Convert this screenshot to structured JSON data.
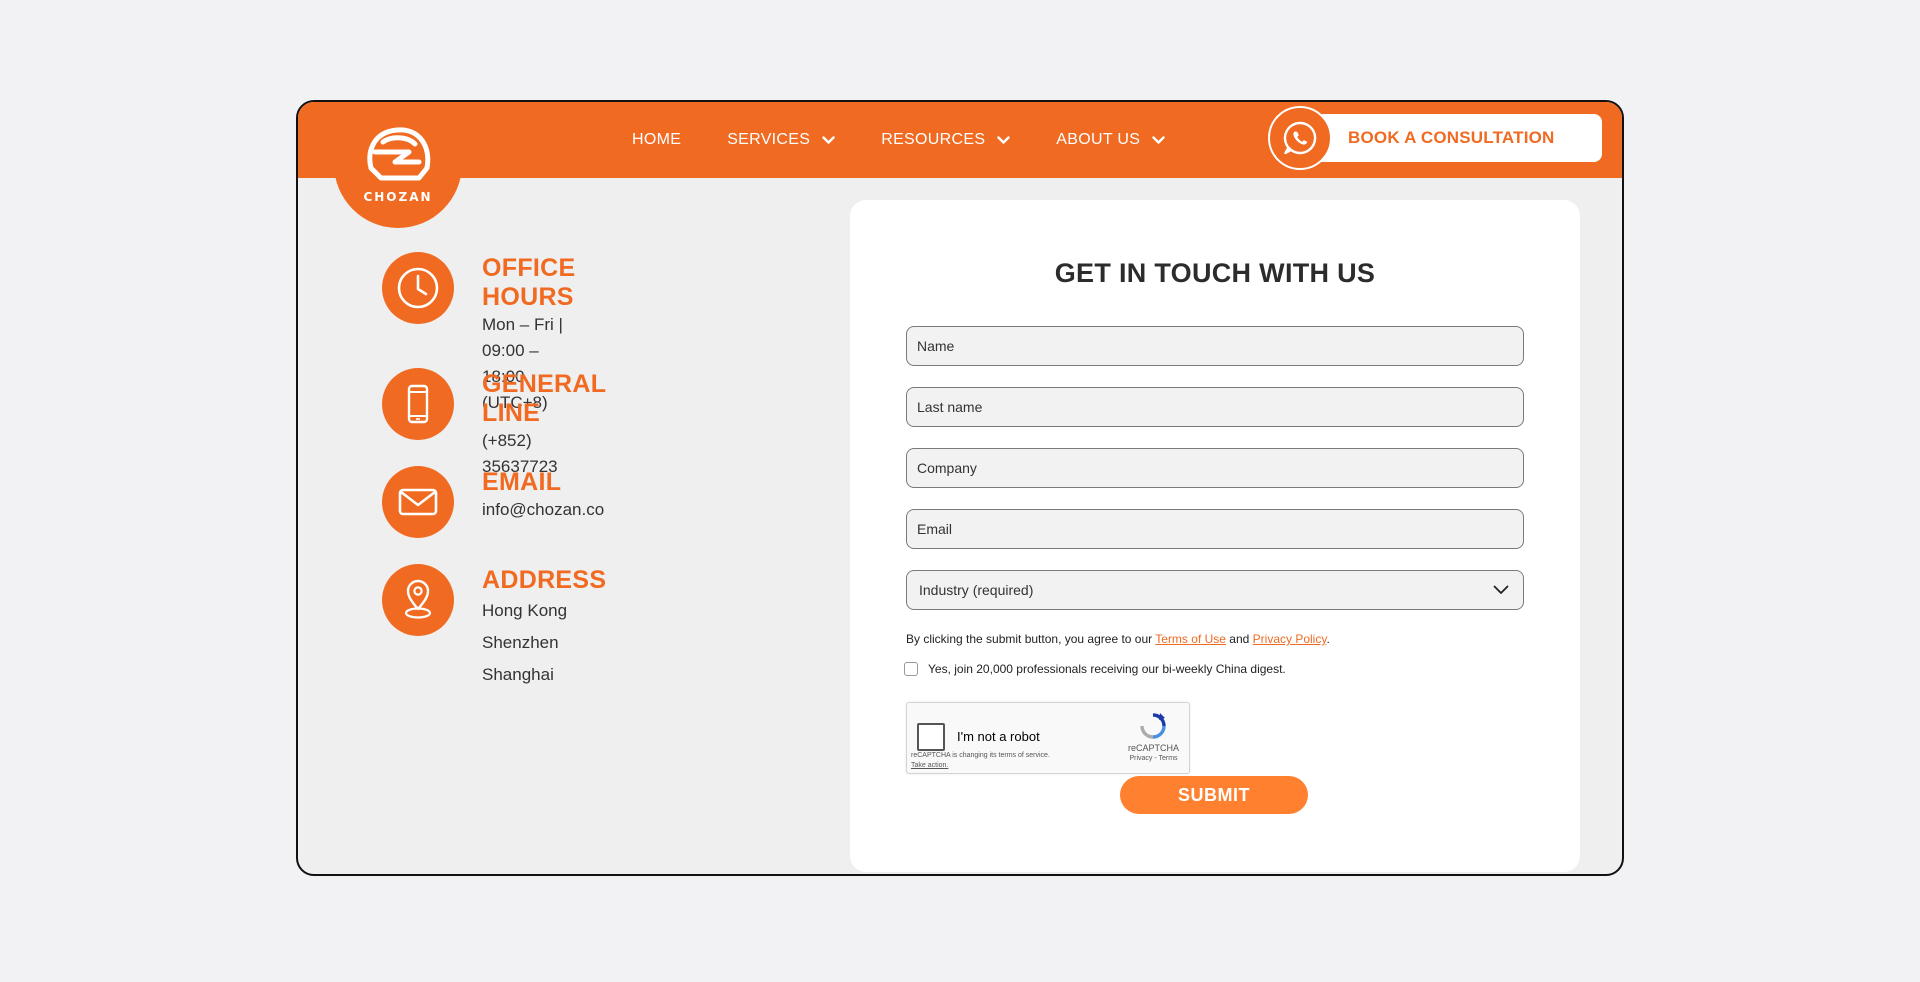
{
  "brand": {
    "name": "CHOZAN"
  },
  "nav": {
    "items": [
      {
        "label": "HOME"
      },
      {
        "label": "SERVICES"
      },
      {
        "label": "RESOURCES"
      },
      {
        "label": "ABOUT US"
      }
    ],
    "cta_label": "BOOK A CONSULTATION"
  },
  "info": {
    "office_hours": {
      "title": "OFFICE HOURS",
      "line1": "Mon – Fri | 09:00 – 18:00",
      "line2": "(UTC+8)"
    },
    "general_line": {
      "title": "GENERAL LINE",
      "phone": "(+852) 35637723"
    },
    "email": {
      "title": "EMAIL",
      "address": "info@chozan.co"
    },
    "address": {
      "title": "ADDRESS",
      "cities": [
        "Hong Kong",
        "Shenzhen",
        "Shanghai"
      ]
    }
  },
  "form": {
    "title": "GET IN TOUCH WITH US",
    "name_placeholder": "Name",
    "lastname_placeholder": "Last name",
    "company_placeholder": "Company",
    "email_placeholder": "Email",
    "industry_value": "Industry (required)",
    "consent_prefix": "By clicking the submit button, you agree to our ",
    "terms_label": "Terms of Use",
    "consent_and": " and ",
    "privacy_label": "Privacy Policy",
    "consent_suffix": ".",
    "digest_label": "Yes, join 20,000 professionals receiving our bi-weekly China digest.",
    "recaptcha": {
      "label": "I'm not a robot",
      "note": "reCAPTCHA is changing its terms of service.",
      "action": "Take action.",
      "brand": "reCAPTCHA",
      "links": "Privacy - Terms"
    },
    "submit_label": "SUBMIT"
  },
  "colors": {
    "accent": "#f06a22",
    "submit": "#ff8130",
    "page_bg": "#f2f2f5"
  }
}
